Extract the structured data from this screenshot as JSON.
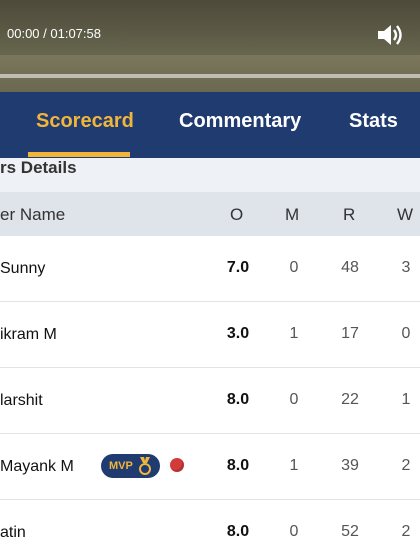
{
  "video": {
    "time": "00:00 / 01:07:58",
    "volume_icon": "volume-icon"
  },
  "tabs": [
    {
      "label": "Scorecard",
      "active": true
    },
    {
      "label": "Commentary",
      "active": false
    },
    {
      "label": "Stats",
      "active": false
    }
  ],
  "section": {
    "title": "rs Details"
  },
  "columns": {
    "name": "er Name",
    "o": "O",
    "m": "M",
    "r": "R",
    "w": "W"
  },
  "rows": [
    {
      "name": "Sunny",
      "o": "7.0",
      "m": "0",
      "r": "48",
      "w": "3"
    },
    {
      "name": "ikram  M",
      "o": "3.0",
      "m": "1",
      "r": "17",
      "w": "0"
    },
    {
      "name": "larshit",
      "o": "8.0",
      "m": "0",
      "r": "22",
      "w": "1"
    },
    {
      "name": "Mayank  M",
      "o": "8.0",
      "m": "1",
      "r": "39",
      "w": "2",
      "badge": "MVP"
    },
    {
      "name": "atin",
      "o": "8.0",
      "m": "0",
      "r": "52",
      "w": "2"
    }
  ],
  "colors": {
    "tab_bar": "#1f3b6f",
    "accent": "#f2b53c"
  }
}
